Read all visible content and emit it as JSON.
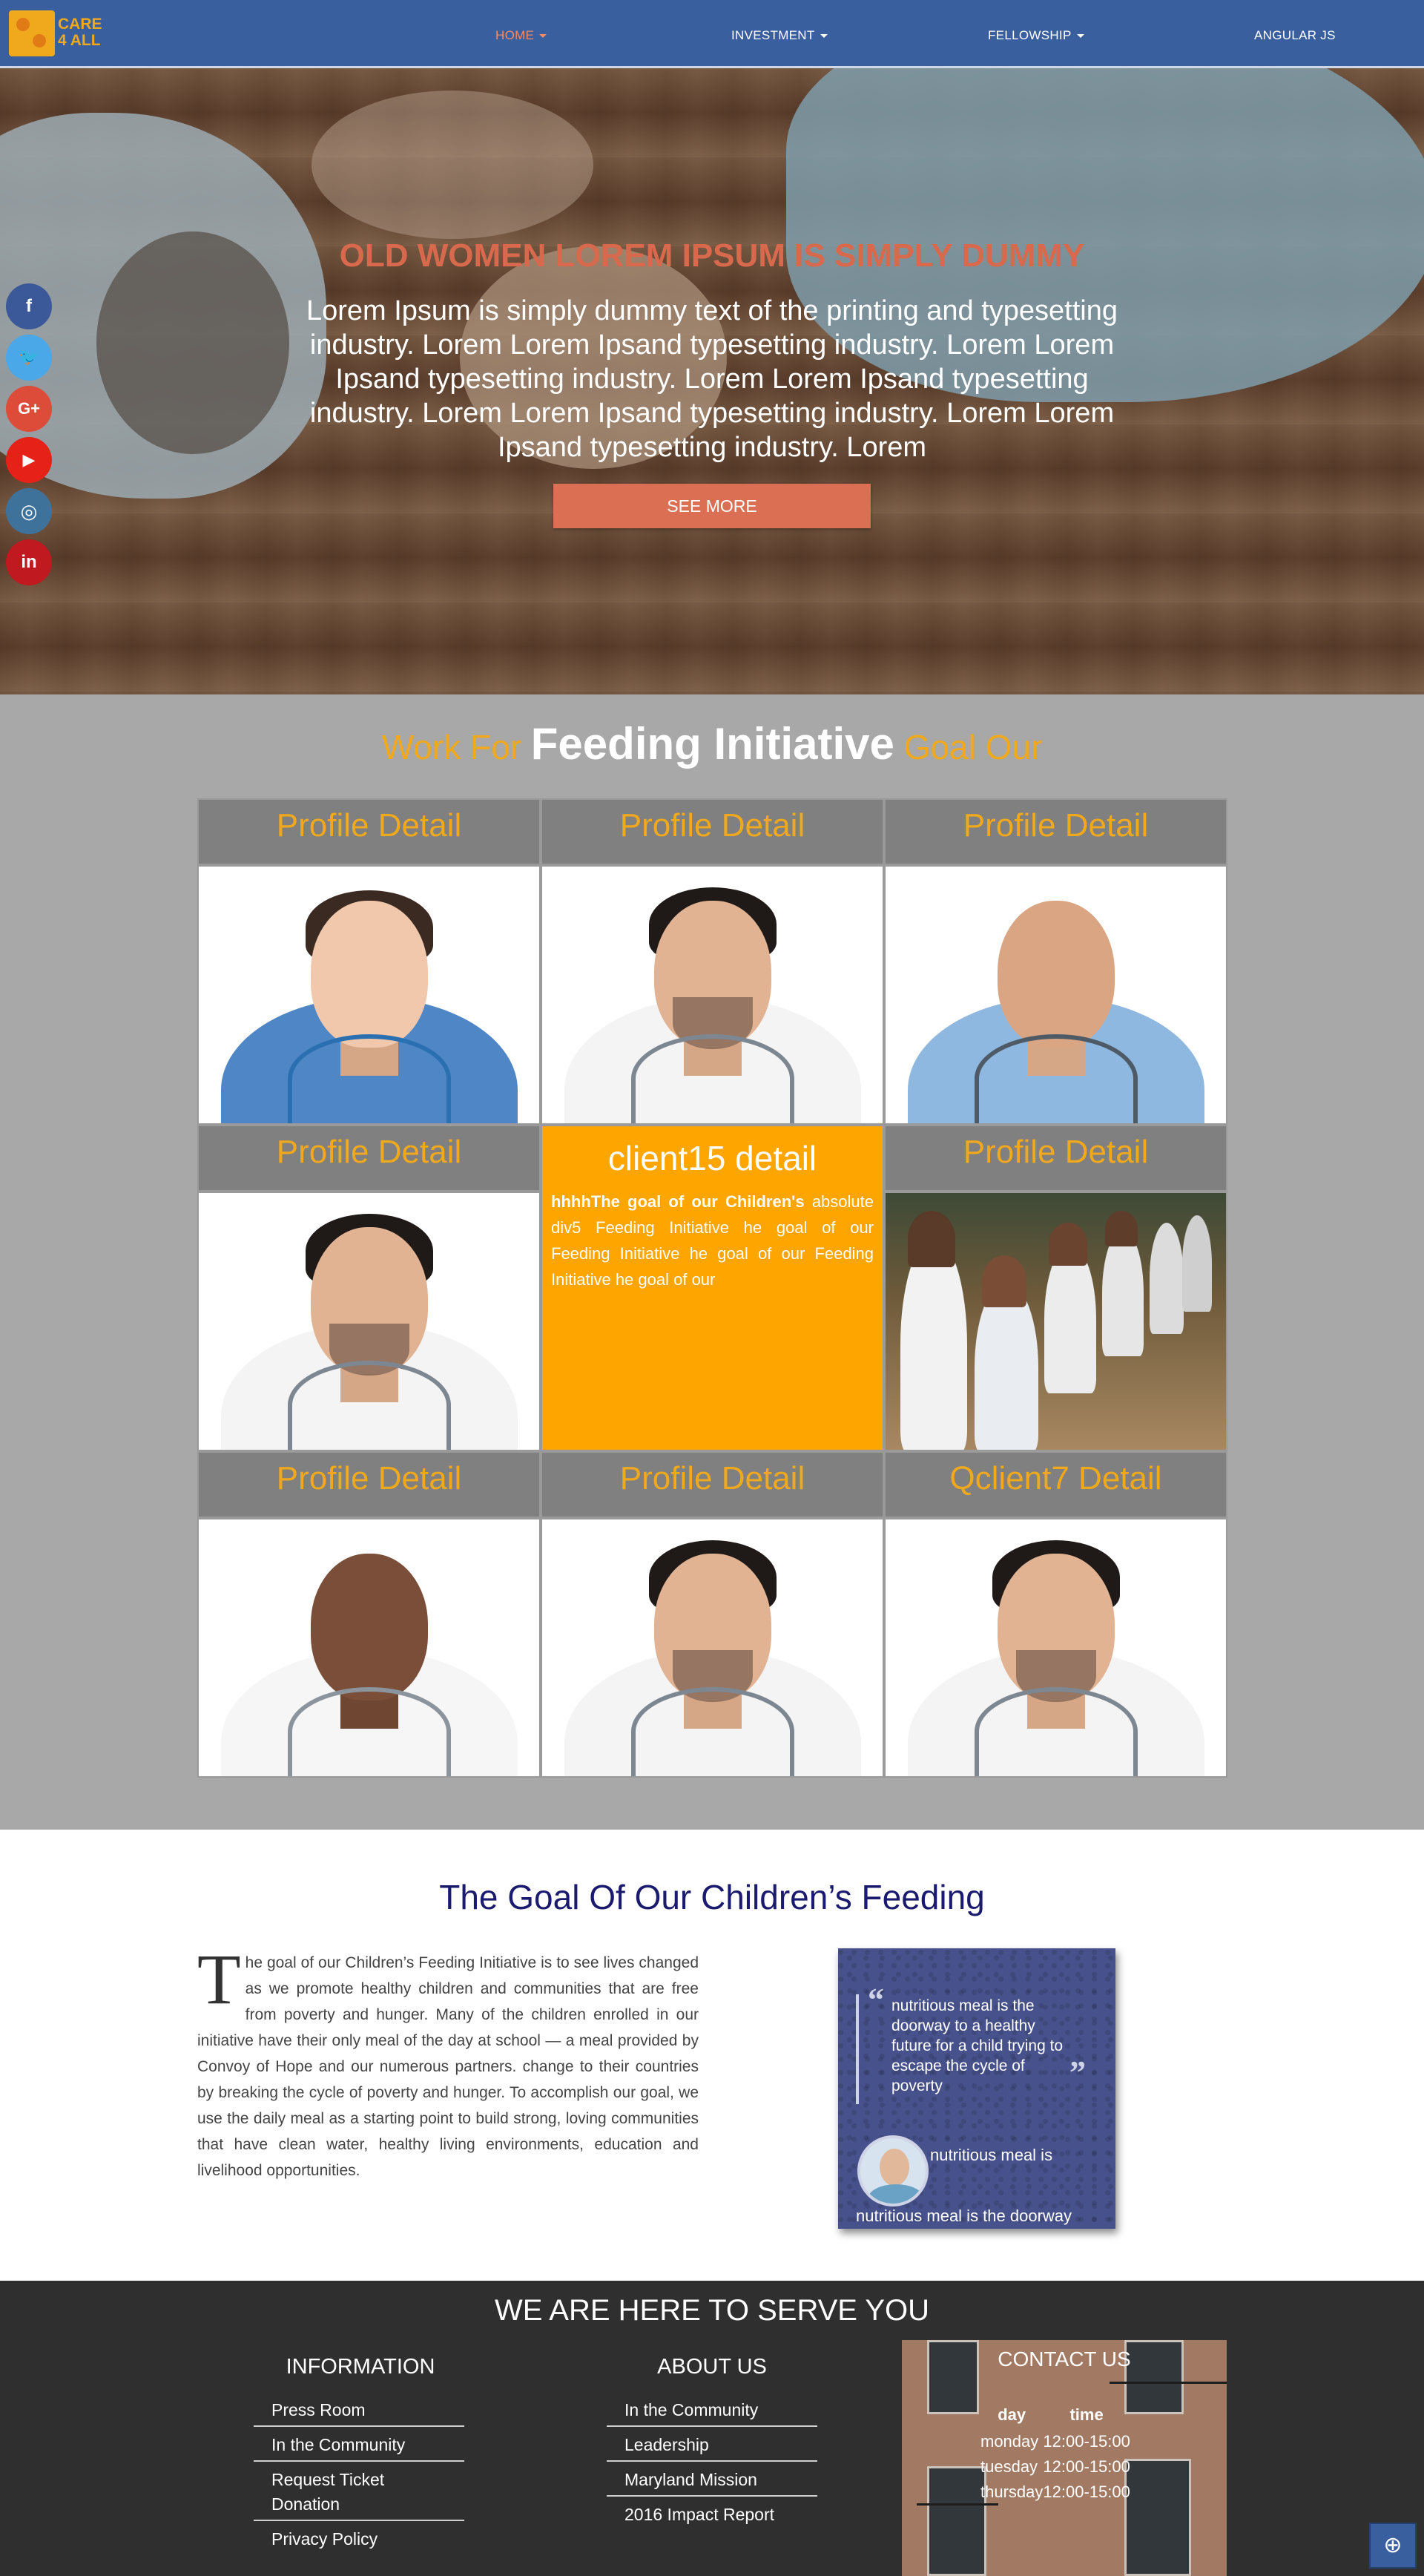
{
  "logo": {
    "text_line1": "CARE",
    "text_line2": "4 ALL"
  },
  "nav": {
    "items": [
      {
        "label": "HOME",
        "dropdown": true,
        "active": true
      },
      {
        "label": "INVESTMENT",
        "dropdown": true,
        "active": false
      },
      {
        "label": "FELLOWSHIP",
        "dropdown": true,
        "active": false
      },
      {
        "label": "ANGULAR JS",
        "dropdown": false,
        "active": false
      }
    ]
  },
  "hero": {
    "title": "OLD WOMEN LOREM IPSUM IS SIMPLY DUMMY",
    "text": "Lorem Ipsum is simply dummy text of the printing and typesetting industry. Lorem Lorem Ipsand typesetting industry. Lorem Lorem Ipsand typesetting industry. Lorem Lorem Ipsand typesetting industry. Lorem Lorem Ipsand typesetting industry. Lorem Lorem Ipsand typesetting industry. Lorem",
    "button": "SEE MORE"
  },
  "social": [
    {
      "icon": "facebook-icon",
      "glyph": "f",
      "color": "#3b5998"
    },
    {
      "icon": "twitter-icon",
      "glyph": "🐦",
      "color": "#4aa8e8"
    },
    {
      "icon": "google-plus-icon",
      "glyph": "G+",
      "color": "#dd4b39"
    },
    {
      "icon": "youtube-icon",
      "glyph": "▶",
      "color": "#e62117"
    },
    {
      "icon": "instagram-icon",
      "glyph": "◎",
      "color": "#3f729b"
    },
    {
      "icon": "linkedin-icon",
      "glyph": "in",
      "color": "#c0191f"
    }
  ],
  "work": {
    "title_left": "Work For",
    "title_big": "Feeding Initiative",
    "title_right": "Goal Our",
    "tiles": [
      {
        "head": "Profile Detail"
      },
      {
        "head": "Profile Detail"
      },
      {
        "head": "Profile Detail"
      },
      {
        "head": "Profile Detail"
      },
      {
        "head": "client15 detail"
      },
      {
        "head": "Profile Detail"
      },
      {
        "head": "Profile Detail"
      },
      {
        "head": "Profile Detail"
      },
      {
        "head": "Qclient7 Detail"
      }
    ],
    "client_box": {
      "title": "client15 detail",
      "text_bold": "hhhhThe goal of our Children's",
      "text": "absolute div5 Feeding Initiative he goal of our Feeding Initiative he goal of our Feeding Initiative he goal of our"
    }
  },
  "goal": {
    "title": "The Goal Of Our Children’s Feeding",
    "dropcap": "T",
    "text": "he goal of our Children’s Feeding Initiative is to see lives changed as we promote healthy children and communities that are free from poverty and hunger. Many of the children enrolled in our initiative have their only meal of the day at school — a meal provided by Convoy of Hope and our numerous partners. change to their countries by breaking the cycle of poverty and hunger. To accomplish our goal, we use the daily meal as a starting point to build strong, loving communities that have clean water, healthy living environments, education and livelihood opportunities.",
    "quote": "nutritious meal is the doorway to a healthy future for a child trying to escape the cycle of poverty",
    "caption": "nutritious meal is",
    "caption_footer": "nutritious meal is the doorway"
  },
  "footer": {
    "title": "WE ARE HERE TO SERVE YOU",
    "information": {
      "title": "INFORMATION",
      "links": [
        "Press Room",
        "In the Community",
        "Request Ticket Donation",
        "Privacy Policy"
      ]
    },
    "about": {
      "title": "ABOUT US",
      "links": [
        "In the Community",
        "Leadership",
        "Maryland Mission",
        "2016 Impact Report"
      ]
    },
    "contact": {
      "title": "CONTACT US",
      "col_day": "day",
      "col_time": "time",
      "rows": [
        {
          "day": "monday",
          "time": "12:00-15:00"
        },
        {
          "day": "tuesday",
          "time": "12:00-15:00"
        },
        {
          "day": "thursday",
          "time": "12:00-15:00"
        }
      ]
    },
    "back_to_top_icon": "arrow-up-circle-icon"
  },
  "colors": {
    "nav_bg": "#3a5f9e",
    "accent_orange": "#f0a81c",
    "hero_title": "#d9694c",
    "button": "#db6f53",
    "section_gray": "#a8a8a8",
    "tile_head": "#808080",
    "client_box": "#ffa500",
    "goal_title": "#1a1a6e",
    "footer_bg": "#2f2f2f"
  }
}
